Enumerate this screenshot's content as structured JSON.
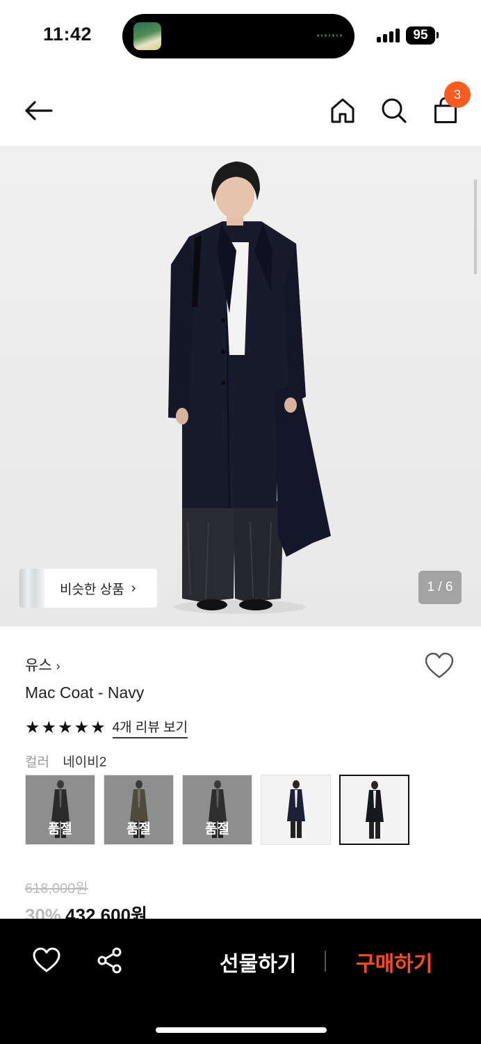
{
  "status_bar": {
    "time": "11:42",
    "battery": "95"
  },
  "header": {
    "cart_count": "3"
  },
  "gallery": {
    "similar_label": "비슷한 상품",
    "page_indicator": "1 / 6"
  },
  "product": {
    "brand": "유스",
    "title": "Mac Coat - Navy",
    "rating_stars": 5,
    "review_link": "4개 리뷰 보기",
    "color_label": "컬러",
    "color_value": "네이비2",
    "options": [
      {
        "sold_out_label": "품절",
        "state": "sold-out",
        "garment_color": "#2a2a2a"
      },
      {
        "sold_out_label": "품절",
        "state": "sold-out",
        "garment_color": "#4e4a3c"
      },
      {
        "sold_out_label": "품절",
        "state": "sold-out",
        "garment_color": "#2e2e2e"
      },
      {
        "state": "available",
        "garment_color": "#1c2038"
      },
      {
        "state": "selected",
        "garment_color": "#15181f"
      }
    ],
    "original_price": "618,000원",
    "discount": "30%",
    "sale_price": "432,600원"
  },
  "bottom_bar": {
    "gift_label": "선물하기",
    "buy_label": "구매하기",
    "buy_color": "#ff4b14"
  }
}
